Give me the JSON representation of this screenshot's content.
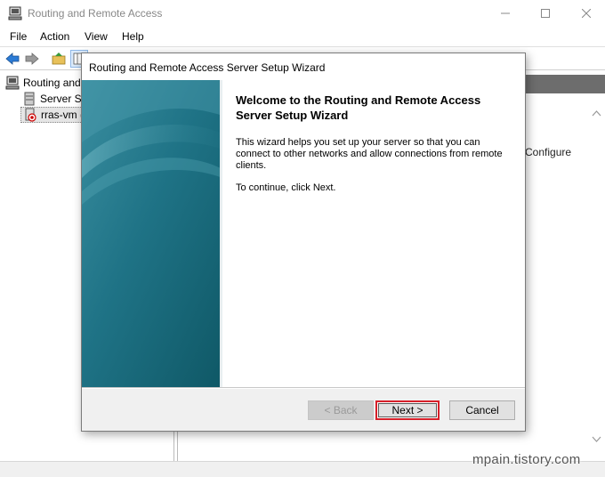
{
  "window": {
    "title": "Routing and Remote Access",
    "controls": {
      "minimize": "—",
      "maximize": "☐",
      "close": "✕"
    }
  },
  "menu": [
    "File",
    "Action",
    "View",
    "Help"
  ],
  "toolbar": {
    "icons": [
      "back-arrow-icon",
      "forward-arrow-icon",
      "up-folder-icon",
      "show-hide-tree-icon",
      "stop-icon",
      "properties-icon",
      "export-icon",
      "help-icon"
    ]
  },
  "tree": {
    "root_label": "Routing and",
    "items": [
      {
        "label": "Server St",
        "icon": "server-status-icon"
      },
      {
        "label": "rras-vm (",
        "icon": "server-stopped-icon"
      }
    ]
  },
  "right_pane": {
    "configure_text": "Configure"
  },
  "watermark": "mpain.tistory.com",
  "wizard": {
    "title": "Routing and Remote Access Server Setup Wizard",
    "heading": "Welcome to the Routing and Remote Access Server Setup Wizard",
    "description": "This wizard helps you set up your server so that you can connect to other networks and allow connections from remote clients.",
    "continue_text": "To continue, click Next.",
    "buttons": {
      "back": "< Back",
      "next": "Next >",
      "cancel": "Cancel"
    },
    "highlight_color": "#d7202a"
  },
  "colors": {
    "wizard_art_teal": "#1a6f80",
    "header_bar": "#6d6d6d"
  }
}
